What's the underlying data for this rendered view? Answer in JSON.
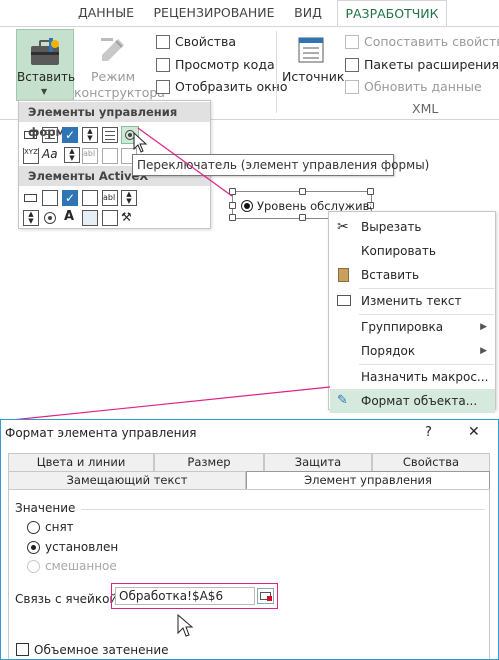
{
  "ribbon": {
    "tabs": [
      "ДАННЫЕ",
      "РЕЦЕНЗИРОВАНИЕ",
      "ВИД",
      "РАЗРАБОТЧИК"
    ],
    "active_tab": "РАЗРАБОТЧИК",
    "insert_label": "Вставить",
    "design_mode_line1": "Режим",
    "design_mode_line2": "конструктора",
    "properties": "Свойства",
    "view_code": "Просмотр кода",
    "run_dialog": "Отобразить окно",
    "source": "Источник",
    "map_properties": "Сопоставить свойства",
    "expansion_packs": "Пакеты расширения",
    "refresh_data": "Обновить данные",
    "xml_group": "XML",
    "accent": "#217346"
  },
  "insert_menu": {
    "form_controls_header": "Элементы управления формы",
    "activex_header": "Элементы ActiveX",
    "tooltip": "Переключатель (элемент управления формы)"
  },
  "sheet": {
    "option_label": "Уровень обслуживани"
  },
  "context_menu": {
    "items": [
      {
        "label": "Вырезать",
        "icon": "scissors-icon"
      },
      {
        "label": "Копировать",
        "icon": ""
      },
      {
        "label": "Вставить",
        "icon": "paste-icon"
      },
      {
        "label": "Изменить текст",
        "icon": "edit-text-icon"
      },
      {
        "label": "Группировка",
        "submenu": true
      },
      {
        "label": "Порядок",
        "submenu": true
      },
      {
        "label": "Назначить макрос...",
        "icon": ""
      },
      {
        "label": "Формат объекта...",
        "icon": "format-icon",
        "highlighted": true
      }
    ],
    "highlight_color": "#d5eadc"
  },
  "dialog": {
    "title": "Формат элемента управления",
    "help": "?",
    "close": "✕",
    "tabs_row1": [
      "Цвета и линии",
      "Размер",
      "Защита",
      "Свойства"
    ],
    "tabs_row2": [
      "Замещающий текст",
      "Элемент управления"
    ],
    "active_tab": "Элемент управления",
    "value_group": "Значение",
    "radio_unchecked": "снят",
    "radio_checked": "установлен",
    "radio_mixed": "смешанное",
    "cell_link_label": "Связь с ячейкой:",
    "cell_link_value": "Обработка!$A$6",
    "shading_label": "Объемное затенение",
    "border_color": "#2c9bd6",
    "highlight_border": "#e0218a"
  }
}
